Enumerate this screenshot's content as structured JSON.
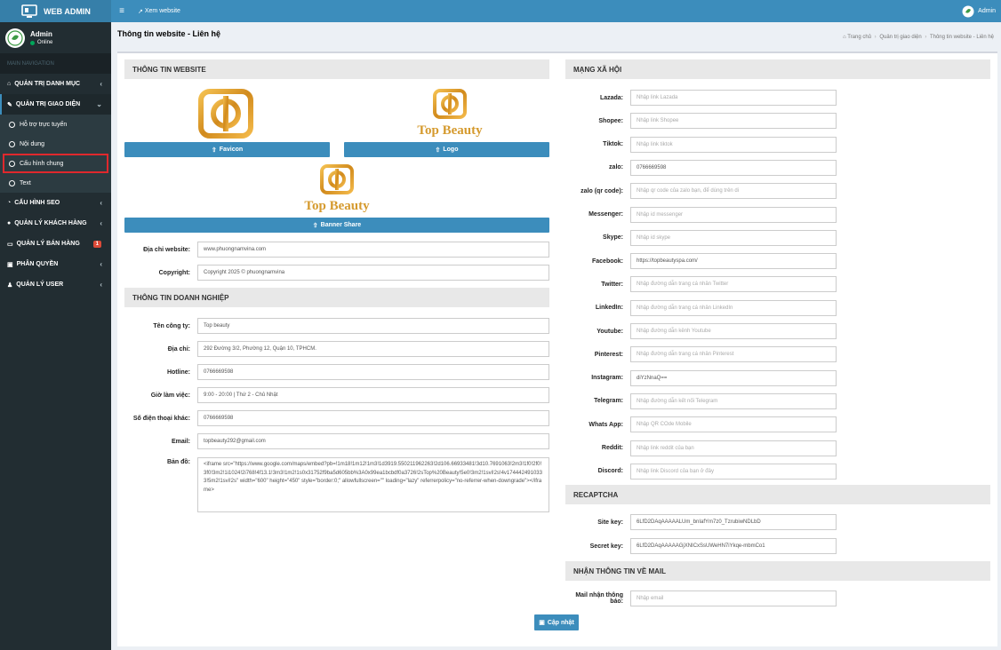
{
  "brand": {
    "name": "WEB ADMIN"
  },
  "user": {
    "name": "Admin",
    "status": "Online"
  },
  "nav": {
    "header": "MAIN NAVIGATION",
    "items": [
      {
        "label": "QUẢN TRỊ DANH MỤC"
      },
      {
        "label": "QUẢN TRỊ GIAO DIỆN"
      },
      {
        "label": "CẤU HÌNH SEO"
      },
      {
        "label": "QUẢN LÝ KHÁCH HÀNG"
      },
      {
        "label": "QUẢN LÝ BÁN HÀNG",
        "badge": "1"
      },
      {
        "label": "PHÂN QUYỀN"
      },
      {
        "label": "QUẢN LÝ USER"
      }
    ],
    "subitems": [
      {
        "label": "Hỗ trợ trực tuyến"
      },
      {
        "label": "Nội dung"
      },
      {
        "label": "Cấu hình chung"
      },
      {
        "label": "Text"
      }
    ]
  },
  "topbar": {
    "view_site": "Xem website",
    "admin": "Admin"
  },
  "page": {
    "title": "Thông tin website - Liên hệ"
  },
  "breadcrumb": [
    "Trang chủ",
    "Quản trị giao diện",
    "Thông tin website - Liên hệ"
  ],
  "logo_text": "Top Beauty",
  "website": {
    "header": "THÔNG TIN WEBSITE",
    "favicon_btn": "Favicon",
    "logo_btn": "Logo",
    "banner_btn": "Banner Share",
    "fields": [
      {
        "label": "Địa chỉ website:",
        "value": "www.phuongnamvina.com",
        "placeholder": ""
      },
      {
        "label": "Copyright:",
        "value": "Copyright 2025 © phuongnamvina",
        "placeholder": ""
      }
    ]
  },
  "company": {
    "header": "THÔNG TIN DOANH NGHIỆP",
    "fields": [
      {
        "label": "Tên công ty:",
        "value": "Top beauty"
      },
      {
        "label": "Địa chỉ:",
        "value": "292 Đường 3/2, Phường 12, Quận 10, TPHCM."
      },
      {
        "label": "Hotline:",
        "value": "0766669598"
      },
      {
        "label": "Giờ làm việc:",
        "value": "9:00 - 20:00 | Thứ 2 - Chủ Nhật"
      },
      {
        "label": "Số điện thoại khác:",
        "value": "0766669598"
      },
      {
        "label": "Email:",
        "value": "topbeauty292@gmail.com"
      }
    ],
    "map_label": "Bản đồ:",
    "map_value": "<iframe src=\"https://www.google.com/maps/embed?pb=!1m18!1m12!1m3!1d3919.550211962263!2d106.66933481!3d10.7691063!2m3!1f0!2f0!3f0!3m2!1i1024!2i768!4f13.1!3m3!1m2!1s0x31752f9ba5d605bb%3A0x99ea1bcbdf0a3726!2sTop%20Beauty!5e0!3m2!1svi!2s!4v1744424910333!5m2!1svi!2s\" width=\"600\" height=\"450\" style=\"border:0;\" allowfullscreen=\"\" loading=\"lazy\" referrerpolicy=\"no-referrer-when-downgrade\"></iframe>"
  },
  "social": {
    "header": "MẠNG XÃ HỘI",
    "fields": [
      {
        "label": "Lazada:",
        "value": "",
        "placeholder": "Nhập link Lazada"
      },
      {
        "label": "Shopee:",
        "value": "",
        "placeholder": "Nhập link Shopee"
      },
      {
        "label": "Tiktok:",
        "value": "",
        "placeholder": "Nhập link tiktok"
      },
      {
        "label": "zalo:",
        "value": "0766669598",
        "placeholder": ""
      },
      {
        "label": "zalo (qr code):",
        "value": "",
        "placeholder": "Nhập qr code của zalo bạn, để dùng trên di"
      },
      {
        "label": "Messenger:",
        "value": "",
        "placeholder": "Nhập id messenger"
      },
      {
        "label": "Skype:",
        "value": "",
        "placeholder": "Nhập id skype"
      },
      {
        "label": "Facebook:",
        "value": "https://topbeautyspa.com/",
        "placeholder": ""
      },
      {
        "label": "Twitter:",
        "value": "",
        "placeholder": "Nhập đường dẫn trang cá nhân Twitter"
      },
      {
        "label": "LinkedIn:",
        "value": "",
        "placeholder": "Nhập đường dẫn trang cá nhân LinkedIn"
      },
      {
        "label": "Youtube:",
        "value": "",
        "placeholder": "Nhập đường dẫn kênh Youtube"
      },
      {
        "label": "Pinterest:",
        "value": "",
        "placeholder": "Nhập đường dẫn trang cá nhân Pinterest"
      },
      {
        "label": "Instagram:",
        "value": "diYzNnaQ==",
        "placeholder": ""
      },
      {
        "label": "Telegram:",
        "value": "",
        "placeholder": "Nhập đường dẫn kết nối Telegram"
      },
      {
        "label": "Whats App:",
        "value": "",
        "placeholder": "Nhập QR COde Mobile"
      },
      {
        "label": "Reddit:",
        "value": "",
        "placeholder": "Nhập link reddit của bạn"
      },
      {
        "label": "Discord:",
        "value": "",
        "placeholder": "Nhập link Discord của bạn ở đây"
      }
    ]
  },
  "recaptcha": {
    "header": "RECAPTCHA",
    "fields": [
      {
        "label": "Site key:",
        "value": "6LfD2DAqAAAAALUm_bnIafYm7z0_TzrubiwNDLbD"
      },
      {
        "label": "Secret key:",
        "value": "6LfD2DAqAAAAAGjXNICxSsUWeHN7iYkqe-mbmCo1"
      }
    ]
  },
  "mail": {
    "header": "NHẬN THÔNG TIN VỀ MAIL",
    "label": "Mail nhận thông báo:",
    "placeholder": "Nhập email"
  },
  "update_btn": "Cập nhật",
  "colors": {
    "sidebar": "#222d32",
    "topbar": "#3c8dbc",
    "button": "#3c8dbc",
    "highlight": "#e0282d",
    "logo_gold": "#d4a02a"
  }
}
